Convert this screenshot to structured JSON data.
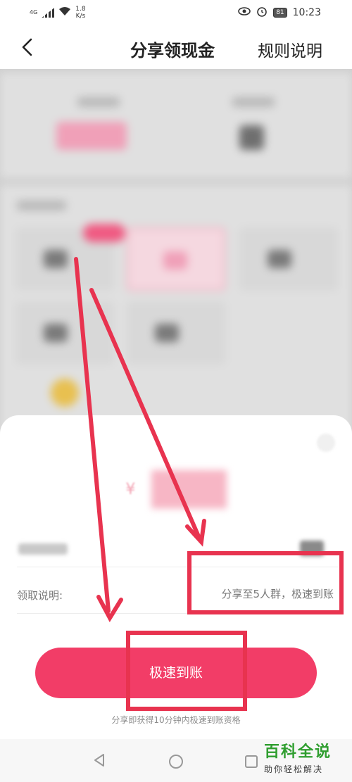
{
  "status_bar": {
    "network": "4G",
    "speed_value": "1.8",
    "speed_unit": "K/s",
    "battery": "81",
    "time": "10:23"
  },
  "header": {
    "back_icon": "chevron-left-icon",
    "title": "分享领现金",
    "rules_link": "规则说明"
  },
  "sheet": {
    "currency_symbol": "¥",
    "claim_label": "领取说明:",
    "claim_value": "分享至5人群，极速到账",
    "cta_label": "极速到账",
    "hint": "分享即获得10分钟内极速到账资格"
  },
  "nav_bar": {
    "icons": [
      "triangle-back-icon",
      "circle-home-icon",
      "square-recent-icon"
    ]
  },
  "annotation": {
    "color": "#e8334f"
  },
  "watermark": {
    "line1": "百科全说",
    "line2": "助你轻松解决"
  }
}
